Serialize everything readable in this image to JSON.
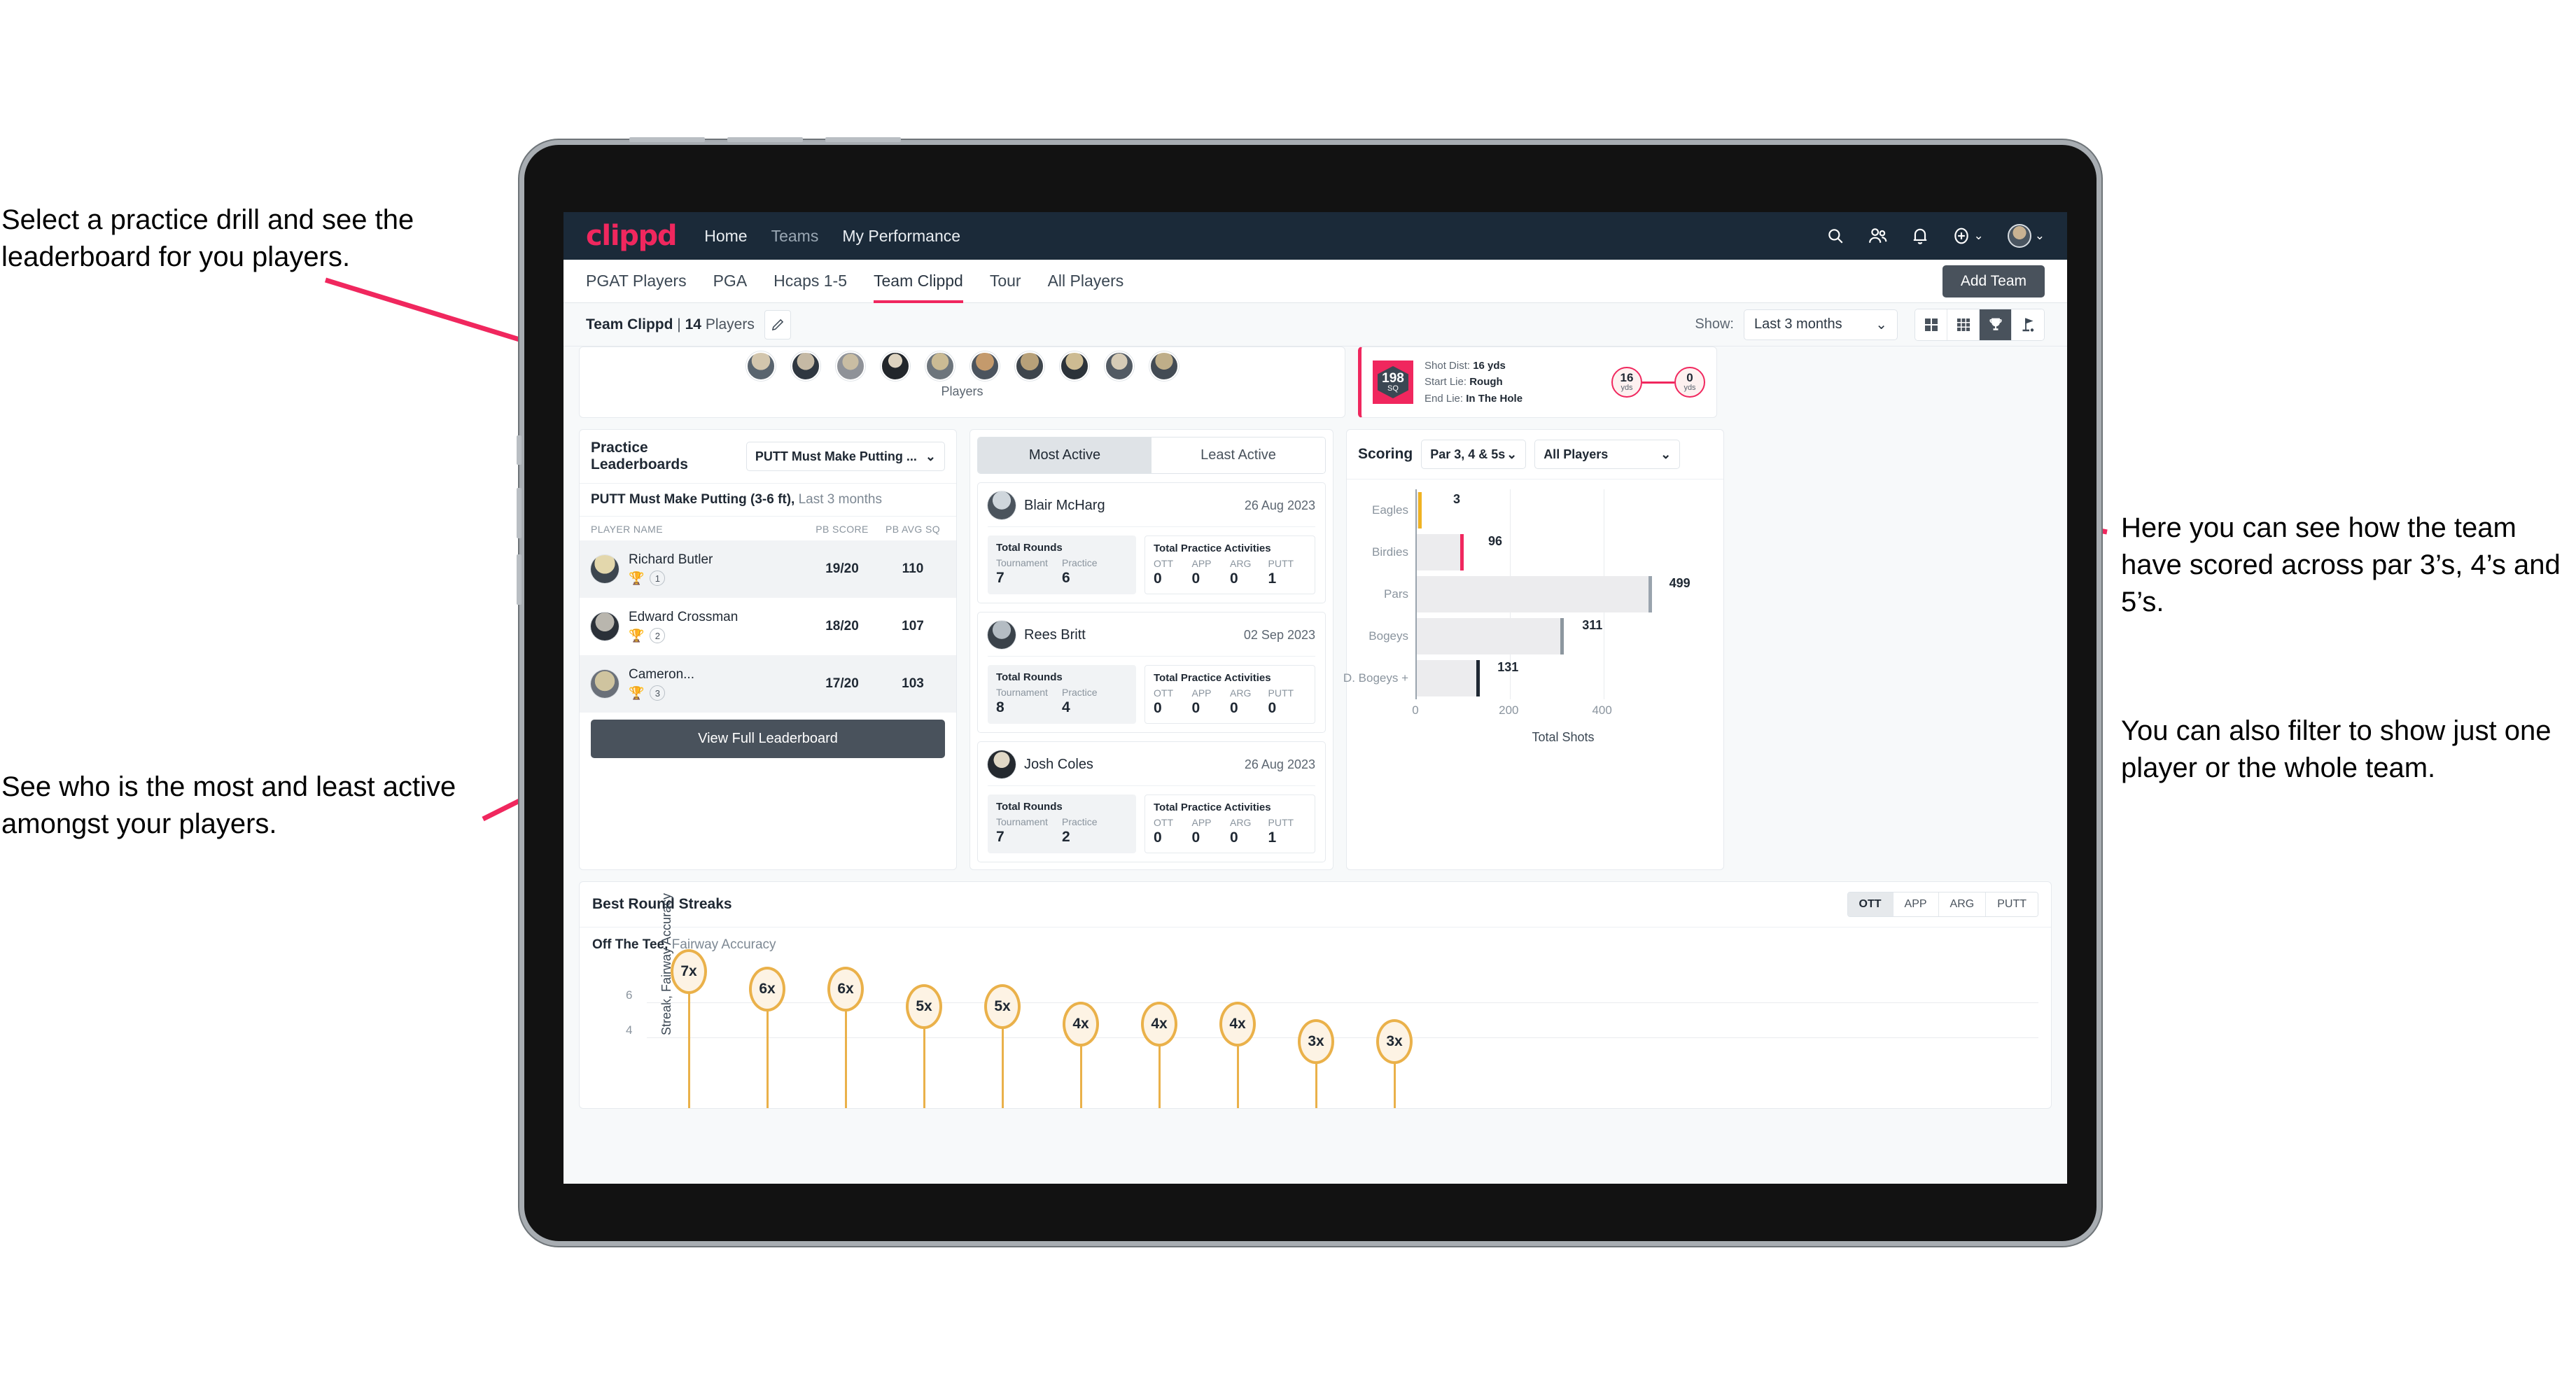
{
  "annotations": {
    "top_left": "Select a practice drill and see the leaderboard for you players.",
    "bottom_left": "See who is the most and least active amongst your players.",
    "right_1": "Here you can see how the team have scored across par 3’s, 4’s and 5’s.",
    "right_2": "You can also filter to show just one player or the whole team."
  },
  "topnav": {
    "logo": "clippd",
    "links": [
      {
        "label": "Home"
      },
      {
        "label": "Teams"
      },
      {
        "label": "My Performance"
      }
    ],
    "icons": [
      "search-icon",
      "people-icon",
      "bell-icon",
      "plus-circle-icon",
      "avatar"
    ]
  },
  "tabs": {
    "items": [
      {
        "label": "PGAT Players",
        "active": false
      },
      {
        "label": "PGA",
        "active": false
      },
      {
        "label": "Hcaps 1-5",
        "active": false
      },
      {
        "label": "Team Clippd",
        "active": true
      },
      {
        "label": "Tour",
        "active": false
      },
      {
        "label": "All Players",
        "active": false
      }
    ],
    "add_team_label": "Add Team"
  },
  "subbar": {
    "team_name": "Team Clippd",
    "separator": "|",
    "player_count": "14",
    "players_word": "Players",
    "edit_icon": "pencil-icon",
    "show_label": "Show:",
    "show_value": "Last 3 months",
    "view_modes": [
      "grid-2x2-icon",
      "grid-3x3-icon",
      "trophy-icon",
      "flag-icon"
    ],
    "view_active_index": 2
  },
  "players_strip": {
    "label": "Players",
    "avatar_count": 10
  },
  "shot_card": {
    "badge_value": "198",
    "badge_unit": "SQ",
    "rows": [
      {
        "label": "Shot Dist:",
        "value": "16 yds"
      },
      {
        "label": "Start Lie:",
        "value": "Rough"
      },
      {
        "label": "End Lie:",
        "value": "In The Hole"
      }
    ],
    "start_dist": "16",
    "start_unit": "yds",
    "end_dist": "0",
    "end_unit": "yds"
  },
  "leaderboard": {
    "title": "Practice Leaderboards",
    "drill_select": "PUTT Must Make Putting ...",
    "subtitle_bold": "PUTT Must Make Putting (3-6 ft),",
    "subtitle_light": " Last 3 months",
    "columns": [
      "PLAYER NAME",
      "PB SCORE",
      "PB AVG SQ"
    ],
    "rows": [
      {
        "name": "Richard Butler",
        "rank": "1",
        "score": "19/20",
        "avg_sq": "110",
        "medal": "gold"
      },
      {
        "name": "Edward Crossman",
        "rank": "2",
        "score": "18/20",
        "avg_sq": "107",
        "medal": "silver"
      },
      {
        "name": "Cameron...",
        "rank": "3",
        "score": "17/20",
        "avg_sq": "103",
        "medal": "bronze"
      }
    ],
    "view_full_label": "View Full Leaderboard"
  },
  "activity": {
    "tabs": [
      {
        "label": "Most Active",
        "active": true
      },
      {
        "label": "Least Active",
        "active": false
      }
    ],
    "rounds_title": "Total Rounds",
    "practice_title": "Total Practice Activities",
    "rounds_keys": [
      "Tournament",
      "Practice"
    ],
    "practice_keys": [
      "OTT",
      "APP",
      "ARG",
      "PUTT"
    ],
    "players": [
      {
        "name": "Blair McHarg",
        "date": "26 Aug 2023",
        "rounds": [
          "7",
          "6"
        ],
        "practice": [
          "0",
          "0",
          "0",
          "1"
        ]
      },
      {
        "name": "Rees Britt",
        "date": "02 Sep 2023",
        "rounds": [
          "8",
          "4"
        ],
        "practice": [
          "0",
          "0",
          "0",
          "0"
        ]
      },
      {
        "name": "Josh Coles",
        "date": "26 Aug 2023",
        "rounds": [
          "7",
          "2"
        ],
        "practice": [
          "0",
          "0",
          "0",
          "1"
        ]
      }
    ]
  },
  "scoring": {
    "title": "Scoring",
    "par_filter": "Par 3, 4 & 5s",
    "player_filter": "All Players"
  },
  "streaks": {
    "title": "Best Round Streaks",
    "segments": [
      {
        "label": "OTT",
        "active": true
      },
      {
        "label": "APP",
        "active": false
      },
      {
        "label": "ARG",
        "active": false
      },
      {
        "label": "PUTT",
        "active": false
      }
    ],
    "subtitle_bold": "Off The Tee,",
    "subtitle_light": " Fairway Accuracy"
  },
  "chart_data": [
    {
      "type": "bar",
      "title": "Scoring",
      "orientation": "horizontal",
      "categories": [
        "Eagles",
        "Birdies",
        "Pars",
        "Bogeys",
        "D. Bogeys +"
      ],
      "values": [
        3,
        96,
        499,
        311,
        131
      ],
      "bar_end_colors": [
        "#f0b323",
        "#f0275e",
        "#9aa4ae",
        "#8d979f",
        "#1f2833"
      ],
      "xlabel": "Total Shots",
      "ylabel": "",
      "xlim": [
        0,
        540
      ],
      "xticks": [
        0,
        200,
        400
      ],
      "grid": true,
      "legend": "none"
    },
    {
      "type": "bar",
      "title": "Best Round Streaks",
      "subtitle": "Off The Tee, Fairway Accuracy",
      "ylabel": "Streak, Fairway Accuracy",
      "values": [
        7,
        6,
        6,
        5,
        5,
        4,
        4,
        4,
        3,
        3
      ],
      "point_labels": [
        "7x",
        "6x",
        "6x",
        "5x",
        "5x",
        "4x",
        "4x",
        "4x",
        "3x",
        "3x"
      ],
      "yticks": [
        4,
        6
      ],
      "ylim": [
        0,
        8
      ],
      "grid": true,
      "marker": "lollipop",
      "marker_color": "#eab14a",
      "legend": "none"
    }
  ]
}
